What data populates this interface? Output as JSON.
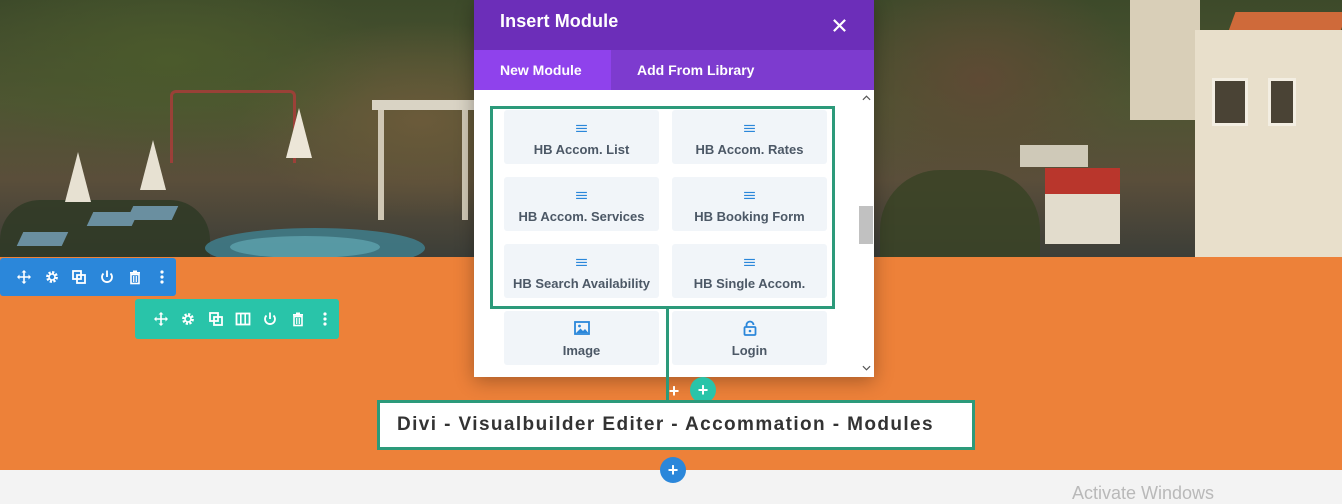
{
  "modal": {
    "title": "Insert Module",
    "close_icon": "close-icon",
    "tabs": [
      {
        "label": "New Module",
        "active": true
      },
      {
        "label": "Add From Library",
        "active": false
      }
    ],
    "modules": [
      {
        "label": "HB Accom. List",
        "icon": "lines-icon"
      },
      {
        "label": "HB Accom. Rates",
        "icon": "lines-icon"
      },
      {
        "label": "HB Accom. Services",
        "icon": "lines-icon"
      },
      {
        "label": "HB Booking Form",
        "icon": "lines-icon"
      },
      {
        "label": "HB Search Availability",
        "icon": "lines-icon"
      },
      {
        "label": "HB Single Accom.",
        "icon": "lines-icon"
      },
      {
        "label": "Image",
        "icon": "image-icon"
      },
      {
        "label": "Login",
        "icon": "lock-icon"
      }
    ]
  },
  "annotation": {
    "caption": "Divi - Visualbuilder Editer - Accommation - Modules"
  },
  "toolbars": {
    "section_icons": [
      "move-icon",
      "gear-icon",
      "duplicate-icon",
      "power-icon",
      "trash-icon",
      "more-icon"
    ],
    "row_icons": [
      "move-icon",
      "gear-icon",
      "duplicate-icon",
      "columns-icon",
      "power-icon",
      "trash-icon",
      "more-icon"
    ]
  },
  "buttons": {
    "add_module": "+",
    "add_row": "+",
    "add_section": "+"
  },
  "watermark": "Activate Windows",
  "colors": {
    "modal_header": "#6c2eb9",
    "modal_tabs": "#7d3bcf",
    "active_tab": "#8f42ec",
    "section_toolbar": "#2b87da",
    "row_toolbar": "#29c4a9",
    "section_bg": "#ed8139",
    "annotation_border": "#2c9a7a",
    "module_bg": "#f1f5f9",
    "module_icon": "#2b87da"
  }
}
